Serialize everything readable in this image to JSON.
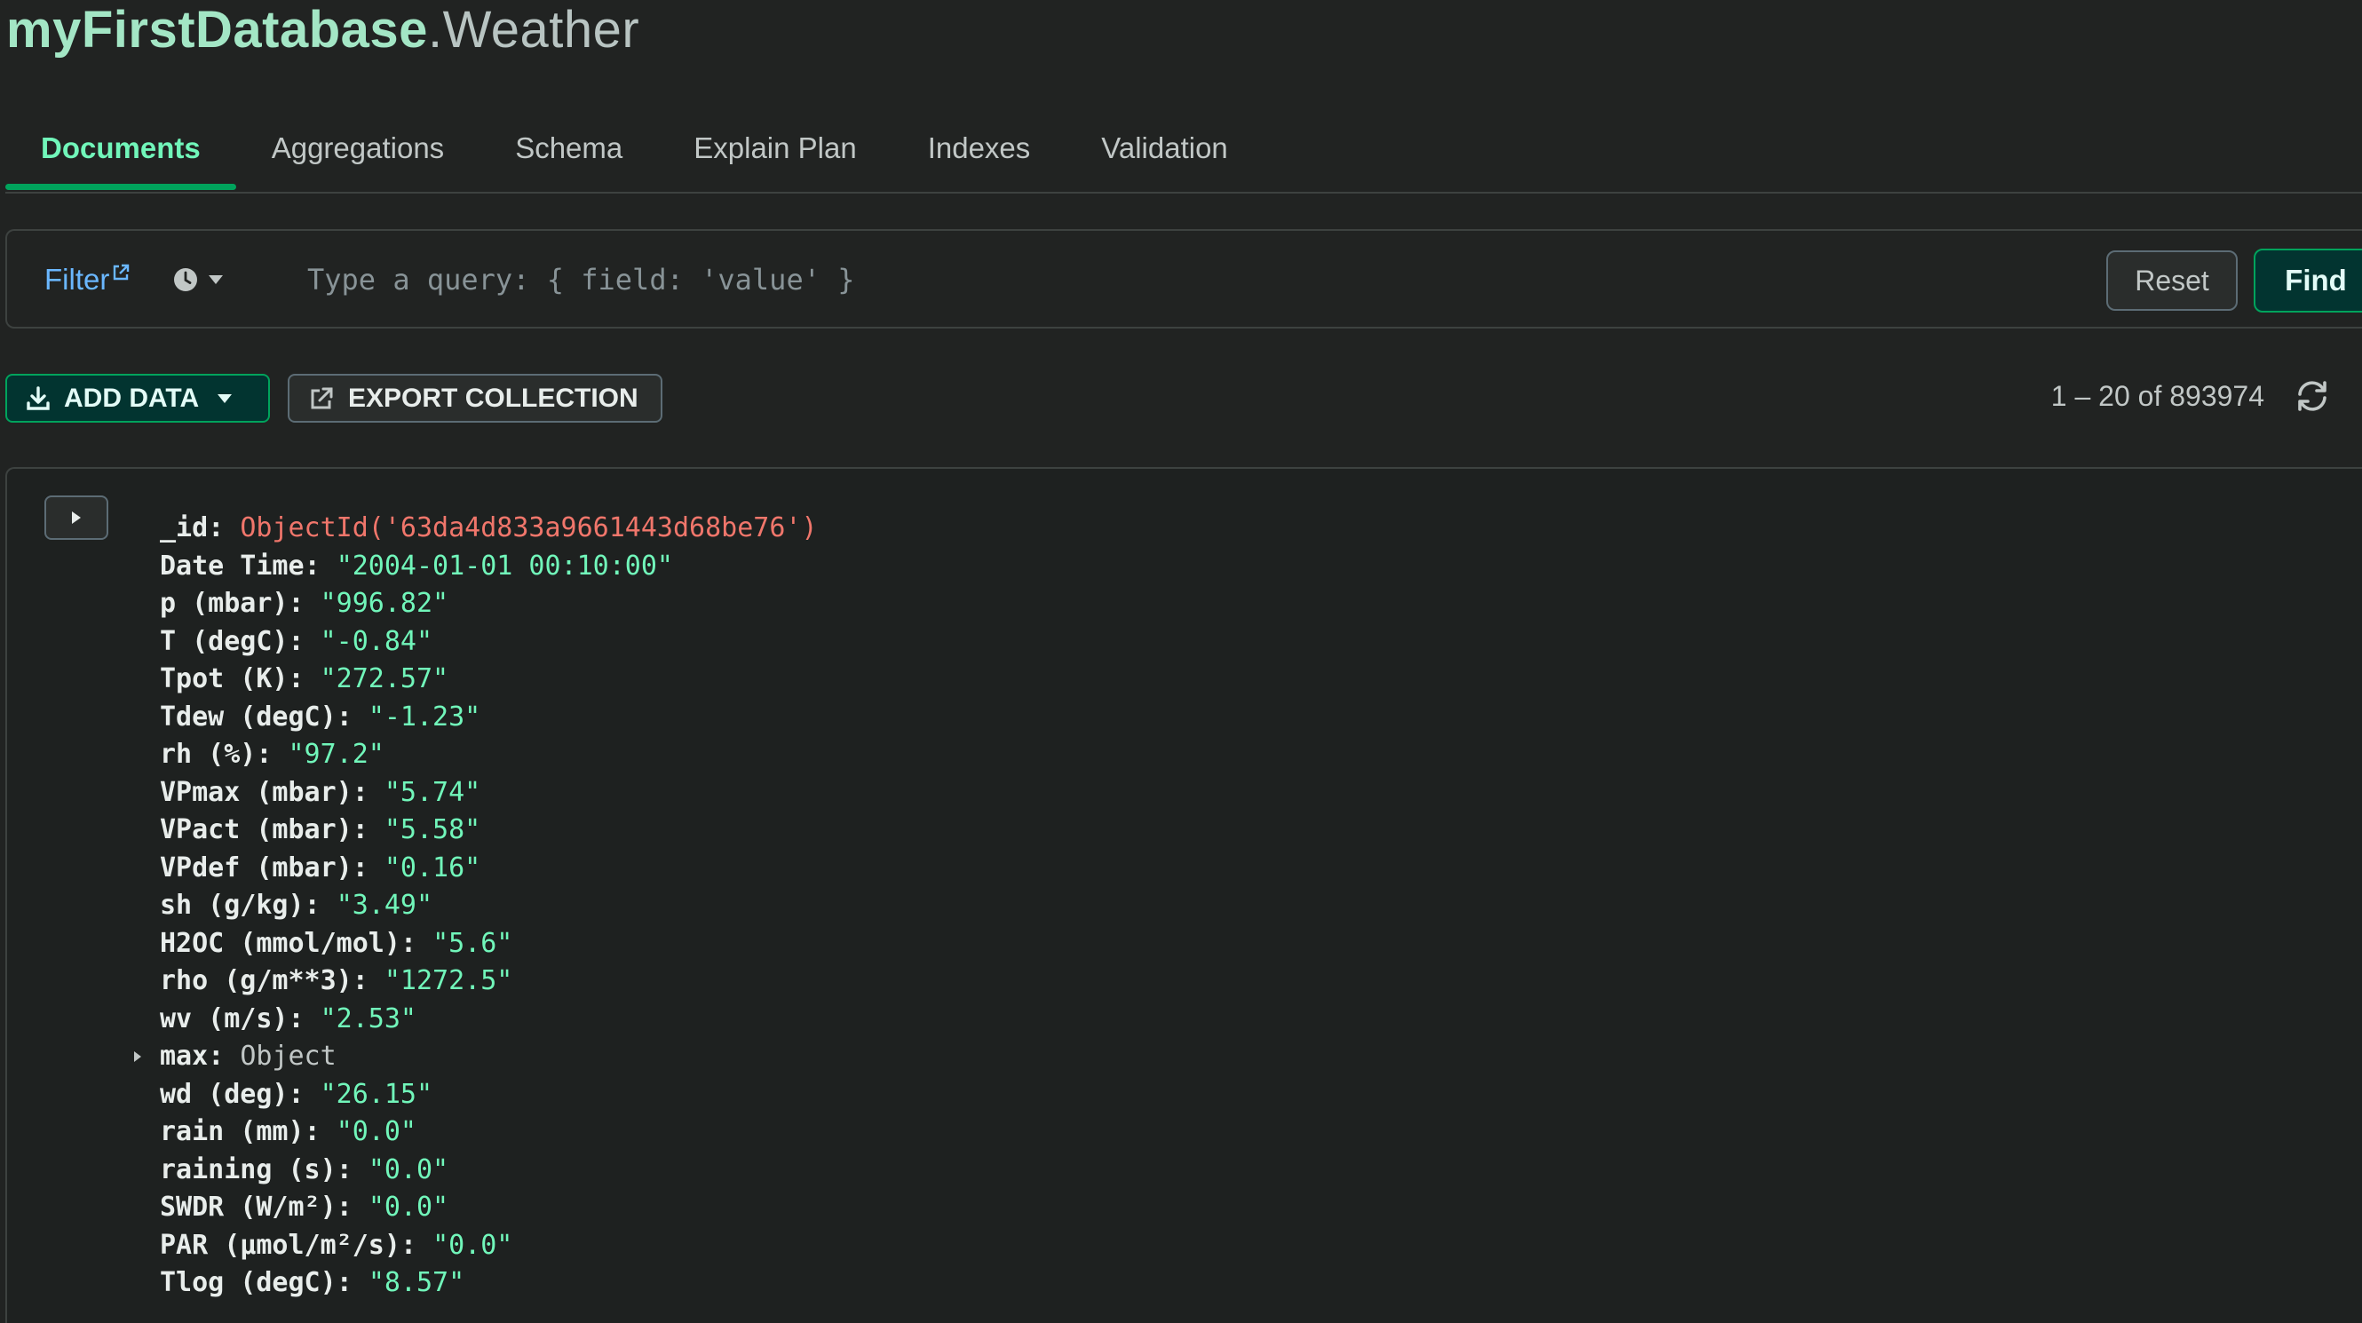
{
  "header": {
    "database": "myFirstDatabase",
    "dot": ".",
    "collection": "Weather"
  },
  "tabs": [
    {
      "label": "Documents",
      "active": true
    },
    {
      "label": "Aggregations",
      "active": false
    },
    {
      "label": "Schema",
      "active": false
    },
    {
      "label": "Explain Plan",
      "active": false
    },
    {
      "label": "Indexes",
      "active": false
    },
    {
      "label": "Validation",
      "active": false
    }
  ],
  "filter": {
    "label": "Filter",
    "placeholder": "Type a query: { field: 'value' }",
    "value": "",
    "reset_label": "Reset",
    "find_label": "Find",
    "icons": [
      "external-link-icon",
      "clock-icon",
      "caret-down-icon"
    ]
  },
  "toolbar": {
    "add_data_label": "ADD DATA",
    "export_label": "EXPORT COLLECTION",
    "pagination": "1 – 20 of 893974",
    "icons": [
      "download-icon",
      "caret-down-icon",
      "export-icon",
      "refresh-icon"
    ]
  },
  "document": {
    "fields": [
      {
        "key": "_id",
        "value": "ObjectId('63da4d833a9661443d68be76')",
        "kind": "oid"
      },
      {
        "key": "Date Time",
        "value": "\"2004-01-01 00:10:00\"",
        "kind": "string"
      },
      {
        "key": "p (mbar)",
        "value": "\"996.82\"",
        "kind": "string"
      },
      {
        "key": "T (degC)",
        "value": "\"-0.84\"",
        "kind": "string"
      },
      {
        "key": "Tpot (K)",
        "value": "\"272.57\"",
        "kind": "string"
      },
      {
        "key": "Tdew (degC)",
        "value": "\"-1.23\"",
        "kind": "string"
      },
      {
        "key": "rh (%)",
        "value": "\"97.2\"",
        "kind": "string"
      },
      {
        "key": "VPmax (mbar)",
        "value": "\"5.74\"",
        "kind": "string"
      },
      {
        "key": "VPact (mbar)",
        "value": "\"5.58\"",
        "kind": "string"
      },
      {
        "key": "VPdef (mbar)",
        "value": "\"0.16\"",
        "kind": "string"
      },
      {
        "key": "sh (g/kg)",
        "value": "\"3.49\"",
        "kind": "string"
      },
      {
        "key": "H2OC (mmol/mol)",
        "value": "\"5.6\"",
        "kind": "string"
      },
      {
        "key": "rho (g/m**3)",
        "value": "\"1272.5\"",
        "kind": "string"
      },
      {
        "key": "wv (m/s)",
        "value": "\"2.53\"",
        "kind": "string"
      },
      {
        "key": "max",
        "value": "Object",
        "kind": "object"
      },
      {
        "key": "wd (deg)",
        "value": "\"26.15\"",
        "kind": "string"
      },
      {
        "key": "rain (mm)",
        "value": "\"0.0\"",
        "kind": "string"
      },
      {
        "key": "raining (s)",
        "value": "\"0.0\"",
        "kind": "string"
      },
      {
        "key": "SWDR (W/m²)",
        "value": "\"0.0\"",
        "kind": "string"
      },
      {
        "key": "PAR (µmol/m²/s)",
        "value": "\"0.0\"",
        "kind": "string"
      },
      {
        "key": "Tlog (degC)",
        "value": "\"8.57\"",
        "kind": "string"
      }
    ]
  }
}
